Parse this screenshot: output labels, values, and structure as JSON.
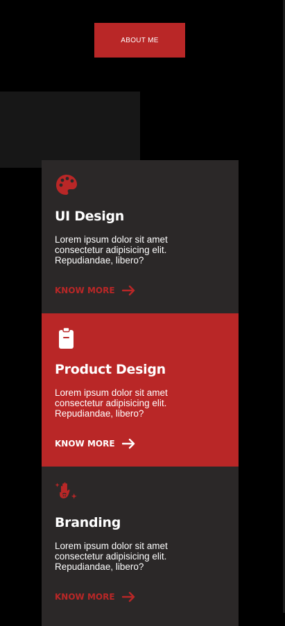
{
  "colors": {
    "accent": "#b92727",
    "card": "#2b2828",
    "panel": "#171717",
    "background": "#000000",
    "text": "#ffffff"
  },
  "header": {
    "about_label": "ABOUT ME"
  },
  "cards": [
    {
      "icon": "palette-icon",
      "title": "UI Design",
      "description": "Lorem ipsum dolor sit amet consectetur adipisicing elit. Repudiandae, libero?",
      "link_label": "KNOW MORE",
      "link_icon": "arrow-right-icon"
    },
    {
      "icon": "clipboard-icon",
      "title": "Product Design",
      "description": "Lorem ipsum dolor sit amet consectetur adipisicing elit. Repudiandae, libero?",
      "link_label": "KNOW MORE",
      "link_icon": "arrow-right-icon"
    },
    {
      "icon": "sparkle-hand-icon",
      "title": "Branding",
      "description": "Lorem ipsum dolor sit amet consectetur adipisicing elit. Repudiandae, libero?",
      "link_label": "KNOW MORE",
      "link_icon": "arrow-right-icon"
    }
  ]
}
